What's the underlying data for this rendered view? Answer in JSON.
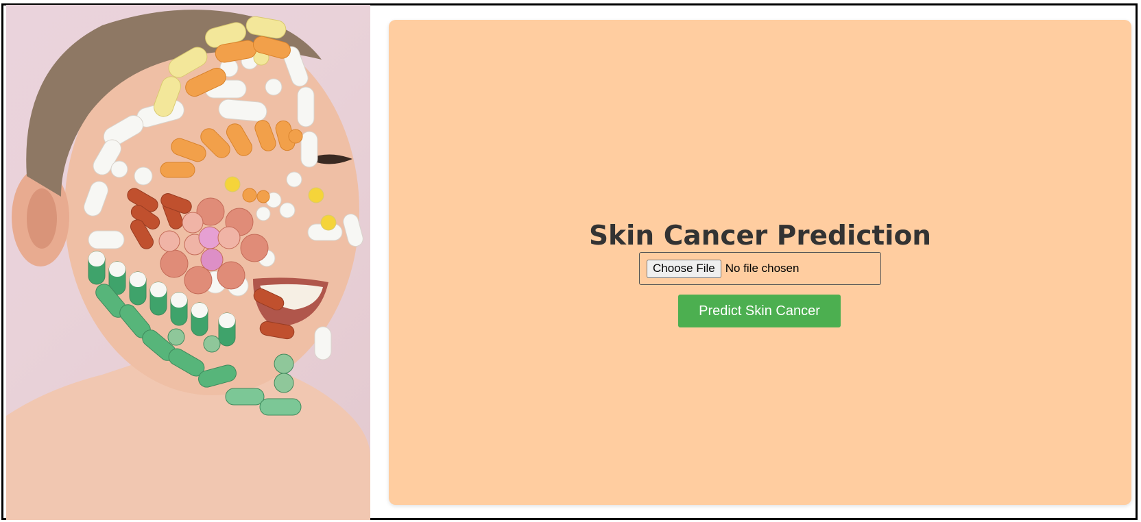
{
  "page": {
    "title": "Skin Cancer Prediction"
  },
  "upload": {
    "choose_label": "Choose File",
    "status_text": "No file chosen"
  },
  "actions": {
    "predict_label": "Predict Skin Cancer"
  },
  "colors": {
    "card_background": "#ffcda0",
    "button_green": "#4caf50",
    "title_text": "#333333"
  },
  "hero_image": {
    "description_icon": "portrait-with-pills-image"
  }
}
